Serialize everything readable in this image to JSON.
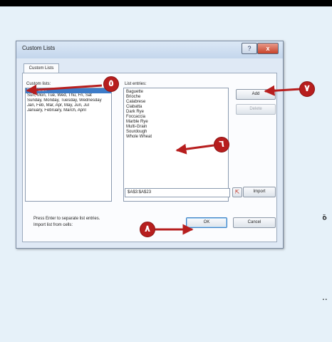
{
  "window": {
    "title": "Custom Lists",
    "help_glyph": "?",
    "close_glyph": "x"
  },
  "tab": {
    "label": "Custom Lists"
  },
  "custom_lists": {
    "label": "Custom lists:",
    "items": [
      {
        "label": "NEW LIST",
        "selected": true
      },
      {
        "label": "Sun, Mon, Tue, Wed, Thu, Fri, Sat",
        "selected": false
      },
      {
        "label": "Sunday, Monday, Tuesday, Wednesday",
        "selected": false
      },
      {
        "label": "Jan, Feb, Mar, Apr, May, Jun, Jul",
        "selected": false
      },
      {
        "label": "January, February, March, April",
        "selected": false
      }
    ]
  },
  "list_entries": {
    "label": "List entries:",
    "lines": [
      "Baguette",
      "Brioche",
      "Calabrese",
      "Ciabatta",
      "Dark Rye",
      "Foccaccia",
      "Marble Rye",
      "Multi-Grain",
      "Sourdough",
      "Whole Wheat"
    ]
  },
  "buttons": {
    "add": "Add",
    "delete": "Delete",
    "import": "Import",
    "ok": "OK",
    "cancel": "Cancel"
  },
  "instructions": {
    "enter_hint": "Press Enter to separate list entries.",
    "import_label": "Import list from cells:",
    "import_value": "$A$3:$A$23",
    "collapse_glyph": "⇱"
  },
  "callouts": {
    "step5": "٥",
    "step6": "٦",
    "step7": "٧",
    "step8": "٨"
  },
  "side_glyphs": {
    "right_mark": "ة",
    "dots": ".."
  },
  "colors": {
    "callout": "#b71e1e",
    "selection": "#3d7cc8",
    "background": "#e6f1f9"
  }
}
